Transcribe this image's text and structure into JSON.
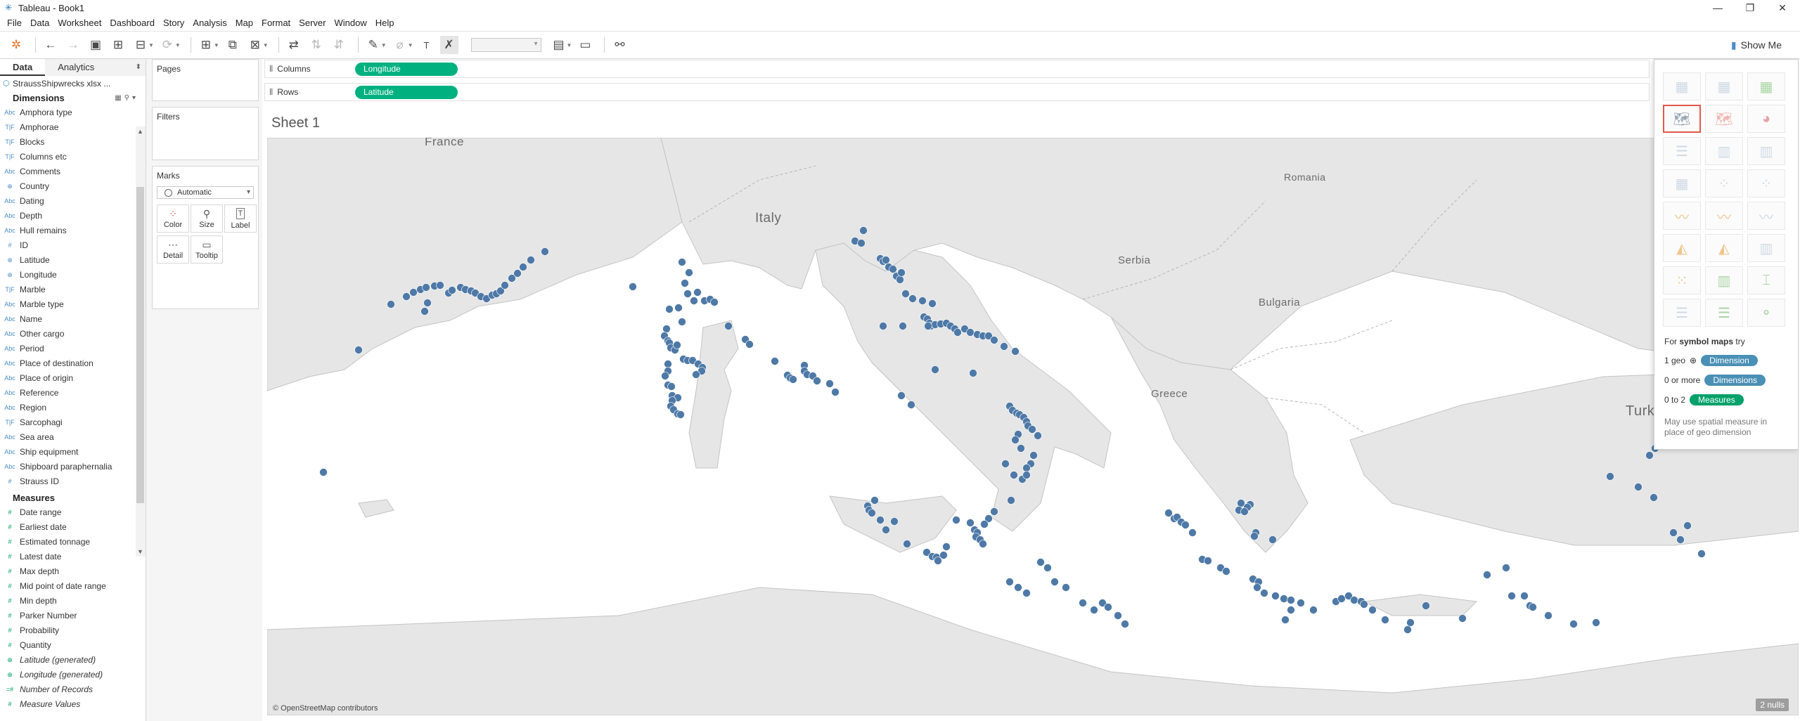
{
  "window": {
    "title": "Tableau - Book1",
    "controls": {
      "minimize": "—",
      "restore": "❐",
      "close": "✕"
    }
  },
  "menu": [
    "File",
    "Data",
    "Worksheet",
    "Dashboard",
    "Story",
    "Analysis",
    "Map",
    "Format",
    "Server",
    "Window",
    "Help"
  ],
  "toolbar": {
    "show_me_label": "Show Me"
  },
  "data_pane": {
    "tab_data": "Data",
    "tab_analytics": "Analytics",
    "datasource": "StraussShipwrecks xlsx ...",
    "dimensions_header": "Dimensions",
    "dimensions": [
      {
        "type": "Abc",
        "name": "Amphora type"
      },
      {
        "type": "T|F",
        "name": "Amphorae"
      },
      {
        "type": "T|F",
        "name": "Blocks"
      },
      {
        "type": "T|F",
        "name": "Columns etc"
      },
      {
        "type": "Abc",
        "name": "Comments"
      },
      {
        "type": "⊕",
        "name": "Country"
      },
      {
        "type": "Abc",
        "name": "Dating"
      },
      {
        "type": "Abc",
        "name": "Depth"
      },
      {
        "type": "Abc",
        "name": "Hull remains"
      },
      {
        "type": "#",
        "name": "ID"
      },
      {
        "type": "⊕",
        "name": "Latitude"
      },
      {
        "type": "⊕",
        "name": "Longitude"
      },
      {
        "type": "T|F",
        "name": "Marble"
      },
      {
        "type": "Abc",
        "name": "Marble type"
      },
      {
        "type": "Abc",
        "name": "Name"
      },
      {
        "type": "Abc",
        "name": "Other cargo"
      },
      {
        "type": "Abc",
        "name": "Period"
      },
      {
        "type": "Abc",
        "name": "Place of destination"
      },
      {
        "type": "Abc",
        "name": "Place of origin"
      },
      {
        "type": "Abc",
        "name": "Reference"
      },
      {
        "type": "Abc",
        "name": "Region"
      },
      {
        "type": "T|F",
        "name": "Sarcophagi"
      },
      {
        "type": "Abc",
        "name": "Sea area"
      },
      {
        "type": "Abc",
        "name": "Ship equipment"
      },
      {
        "type": "Abc",
        "name": "Shipboard paraphernalia"
      },
      {
        "type": "#",
        "name": "Strauss ID"
      }
    ],
    "measures_header": "Measures",
    "measures": [
      {
        "type": "#",
        "name": "Date range",
        "italic": false
      },
      {
        "type": "#",
        "name": "Earliest date",
        "italic": false
      },
      {
        "type": "#",
        "name": "Estimated tonnage",
        "italic": false
      },
      {
        "type": "#",
        "name": "Latest date",
        "italic": false
      },
      {
        "type": "#",
        "name": "Max depth",
        "italic": false
      },
      {
        "type": "#",
        "name": "Mid point of date range",
        "italic": false
      },
      {
        "type": "#",
        "name": "Min depth",
        "italic": false
      },
      {
        "type": "#",
        "name": "Parker Number",
        "italic": false
      },
      {
        "type": "#",
        "name": "Probability",
        "italic": false
      },
      {
        "type": "#",
        "name": "Quantity",
        "italic": false
      },
      {
        "type": "⊕",
        "name": "Latitude (generated)",
        "italic": true
      },
      {
        "type": "⊕",
        "name": "Longitude (generated)",
        "italic": true
      },
      {
        "type": "=#",
        "name": "Number of Records",
        "italic": true
      },
      {
        "type": "#",
        "name": "Measure Values",
        "italic": true
      }
    ]
  },
  "cards": {
    "pages": "Pages",
    "filters": "Filters",
    "marks": "Marks",
    "mark_type": "Automatic",
    "mark_buttons": [
      {
        "name": "color",
        "label": "Color",
        "icon": "⁘"
      },
      {
        "name": "size",
        "label": "Size",
        "icon": "⚲"
      },
      {
        "name": "label",
        "label": "Label",
        "icon": "T"
      },
      {
        "name": "detail",
        "label": "Detail",
        "icon": "⋯"
      },
      {
        "name": "tooltip",
        "label": "Tooltip",
        "icon": "▭"
      }
    ]
  },
  "shelves": {
    "columns_label": "Columns",
    "columns_pill": "Longitude",
    "rows_label": "Rows",
    "rows_pill": "Latitude"
  },
  "sheet": {
    "title": "Sheet 1",
    "map_labels": [
      {
        "name": "france",
        "text": "France"
      },
      {
        "name": "italy",
        "text": "Italy"
      },
      {
        "name": "romania",
        "text": "Romania"
      },
      {
        "name": "serbia",
        "text": "Serbia"
      },
      {
        "name": "bulgaria",
        "text": "Bulgaria"
      },
      {
        "name": "greece",
        "text": "Greece"
      },
      {
        "name": "turkey",
        "text": "Turkey"
      }
    ],
    "attribution": "© OpenStreetMap contributors",
    "nulls": "2 nulls",
    "mark_color": "#4e79a7"
  },
  "show_me": {
    "hint_prefix": "For",
    "hint_bold": "symbol maps",
    "hint_suffix": "try",
    "req1_prefix": "1 geo",
    "req1_chip": "Dimension",
    "req2_prefix": "0 or more",
    "req2_chip": "Dimensions",
    "req3_prefix": "0 to 2",
    "req3_chip": "Measures",
    "note": "May use spatial measure in place of geo dimension"
  }
}
